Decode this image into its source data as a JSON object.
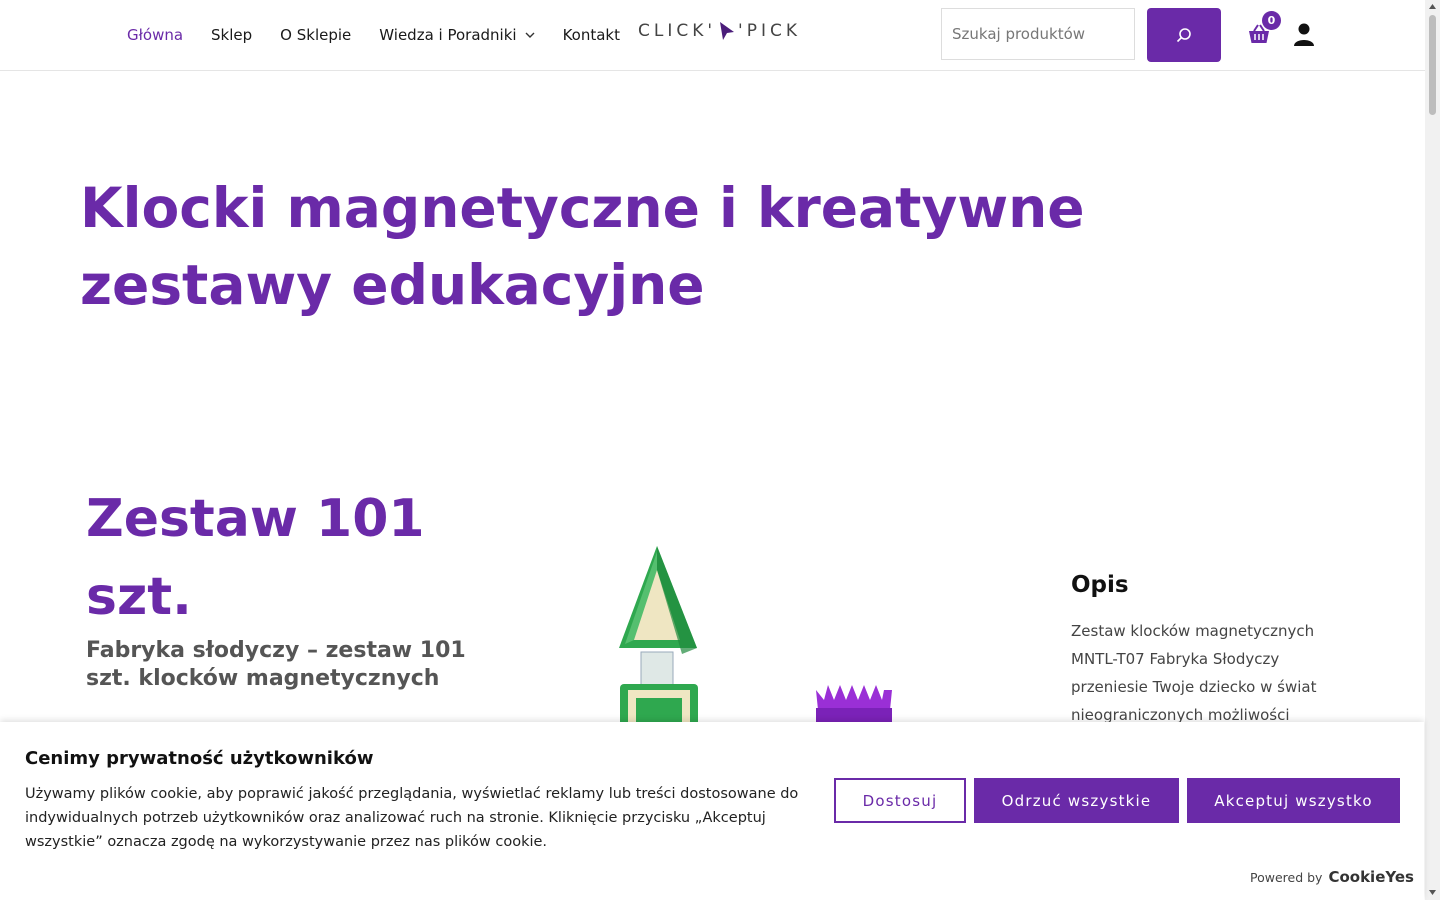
{
  "nav": {
    "items": [
      {
        "label": "Główna"
      },
      {
        "label": "Sklep"
      },
      {
        "label": "O Sklepie"
      },
      {
        "label": "Wiedza i Poradniki"
      },
      {
        "label": "Kontakt"
      }
    ]
  },
  "logo": {
    "left": "CLICK'",
    "right": "'PICK"
  },
  "search": {
    "placeholder": "Szukaj produktów"
  },
  "cart": {
    "count": "0"
  },
  "hero": {
    "title": "Klocki magnetyczne i kreatywne zestawy edukacyjne"
  },
  "product": {
    "title": "Zestaw 101 szt.",
    "subtitle": "Fabryka słodyczy – zestaw 101 szt. klocków magnetycznych",
    "description_heading": "Opis",
    "description_text": "Zestaw klocków magnetycznych MNTL-T07 Fabryka Słodyczy przeniesie Twoje dziecko w świat nieograniczonych możliwości"
  },
  "cookie": {
    "title": "Cenimy prywatność użytkowników",
    "text": "Używamy plików cookie, aby poprawić jakość przeglądania, wyświetlać reklamy lub treści dostosowane do indywidualnych potrzeb użytkowników oraz analizować ruch na stronie. Kliknięcie przycisku „Akceptuj wszystkie” oznacza zgodę na wykorzystywanie przez nas plików cookie.",
    "customize_label": "Dostosuj",
    "reject_label": "Odrzuć wszystkie",
    "accept_label": "Akceptuj wszystko",
    "powered_by": "Powered by",
    "brand": "CookieYes"
  },
  "colors": {
    "accent": "#6a2aa8"
  }
}
